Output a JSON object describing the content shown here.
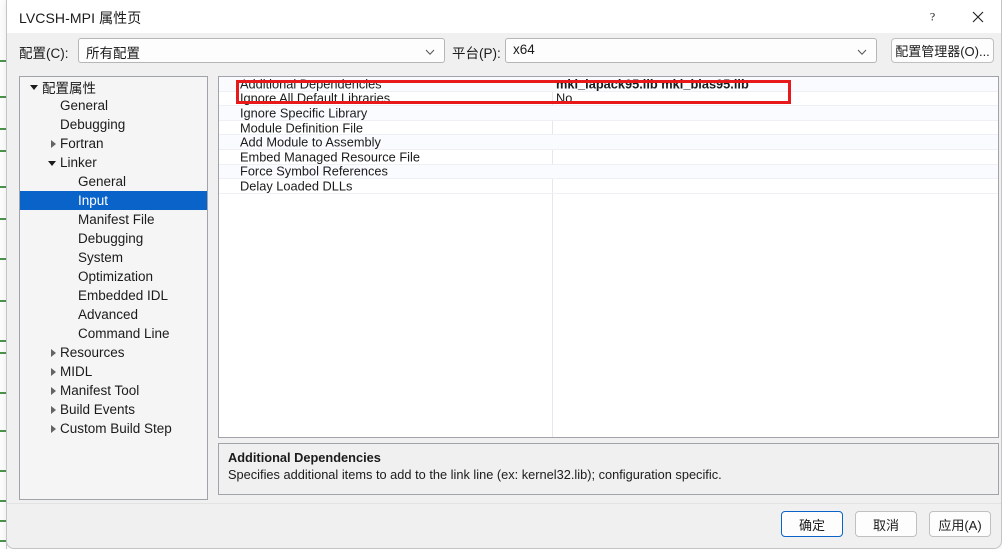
{
  "background": {
    "description": "code-editor-behind-dialog"
  },
  "dialog": {
    "title": "LVCSH-MPI 属性页",
    "help_icon": "question-mark-icon",
    "close_icon": "close-icon"
  },
  "config_bar": {
    "config_label": "配置(C):",
    "config_value": "所有配置",
    "platform_label": "平台(P):",
    "platform_value": "x64",
    "config_manager_button": "配置管理器(O)...",
    "dropdown_icon": "chevron-down-icon"
  },
  "tree": {
    "items": [
      {
        "label": "配置属性",
        "indent": 0,
        "twisty": "expanded",
        "selected": false
      },
      {
        "label": "General",
        "indent": 1,
        "twisty": "none",
        "selected": false
      },
      {
        "label": "Debugging",
        "indent": 1,
        "twisty": "none",
        "selected": false
      },
      {
        "label": "Fortran",
        "indent": 1,
        "twisty": "collapsed",
        "selected": false
      },
      {
        "label": "Linker",
        "indent": 1,
        "twisty": "expanded",
        "selected": false
      },
      {
        "label": "General",
        "indent": 2,
        "twisty": "none",
        "selected": false
      },
      {
        "label": "Input",
        "indent": 2,
        "twisty": "none",
        "selected": true
      },
      {
        "label": "Manifest File",
        "indent": 2,
        "twisty": "none",
        "selected": false
      },
      {
        "label": "Debugging",
        "indent": 2,
        "twisty": "none",
        "selected": false
      },
      {
        "label": "System",
        "indent": 2,
        "twisty": "none",
        "selected": false
      },
      {
        "label": "Optimization",
        "indent": 2,
        "twisty": "none",
        "selected": false
      },
      {
        "label": "Embedded IDL",
        "indent": 2,
        "twisty": "none",
        "selected": false
      },
      {
        "label": "Advanced",
        "indent": 2,
        "twisty": "none",
        "selected": false
      },
      {
        "label": "Command Line",
        "indent": 2,
        "twisty": "none",
        "selected": false
      },
      {
        "label": "Resources",
        "indent": 1,
        "twisty": "collapsed",
        "selected": false
      },
      {
        "label": "MIDL",
        "indent": 1,
        "twisty": "collapsed",
        "selected": false
      },
      {
        "label": "Manifest Tool",
        "indent": 1,
        "twisty": "collapsed",
        "selected": false
      },
      {
        "label": "Build Events",
        "indent": 1,
        "twisty": "collapsed",
        "selected": false
      },
      {
        "label": "Custom Build Step",
        "indent": 1,
        "twisty": "collapsed",
        "selected": false
      }
    ]
  },
  "grid": {
    "rows": [
      {
        "name": "Additional Dependencies",
        "value": "mkl_lapack95.lib mkl_blas95.lib",
        "bold": true,
        "highlighted": true
      },
      {
        "name": "Ignore All Default Libraries",
        "value": "No",
        "bold": false,
        "highlighted": false
      },
      {
        "name": "Ignore Specific Library",
        "value": "",
        "bold": false,
        "highlighted": false
      },
      {
        "name": "Module Definition File",
        "value": "",
        "bold": false,
        "highlighted": false
      },
      {
        "name": "Add Module to Assembly",
        "value": "",
        "bold": false,
        "highlighted": false
      },
      {
        "name": "Embed Managed Resource File",
        "value": "",
        "bold": false,
        "highlighted": false
      },
      {
        "name": "Force Symbol References",
        "value": "",
        "bold": false,
        "highlighted": false
      },
      {
        "name": "Delay Loaded DLLs",
        "value": "",
        "bold": false,
        "highlighted": false
      }
    ]
  },
  "description": {
    "title": "Additional Dependencies",
    "text": "Specifies additional items to add to the link line (ex: kernel32.lib); configuration specific."
  },
  "footer": {
    "ok": "确定",
    "cancel": "取消",
    "apply": "应用(A)"
  },
  "colors": {
    "selection": "#0a63c9",
    "annotation": "#e8191a",
    "dialog_bg": "#f0f0f0"
  }
}
